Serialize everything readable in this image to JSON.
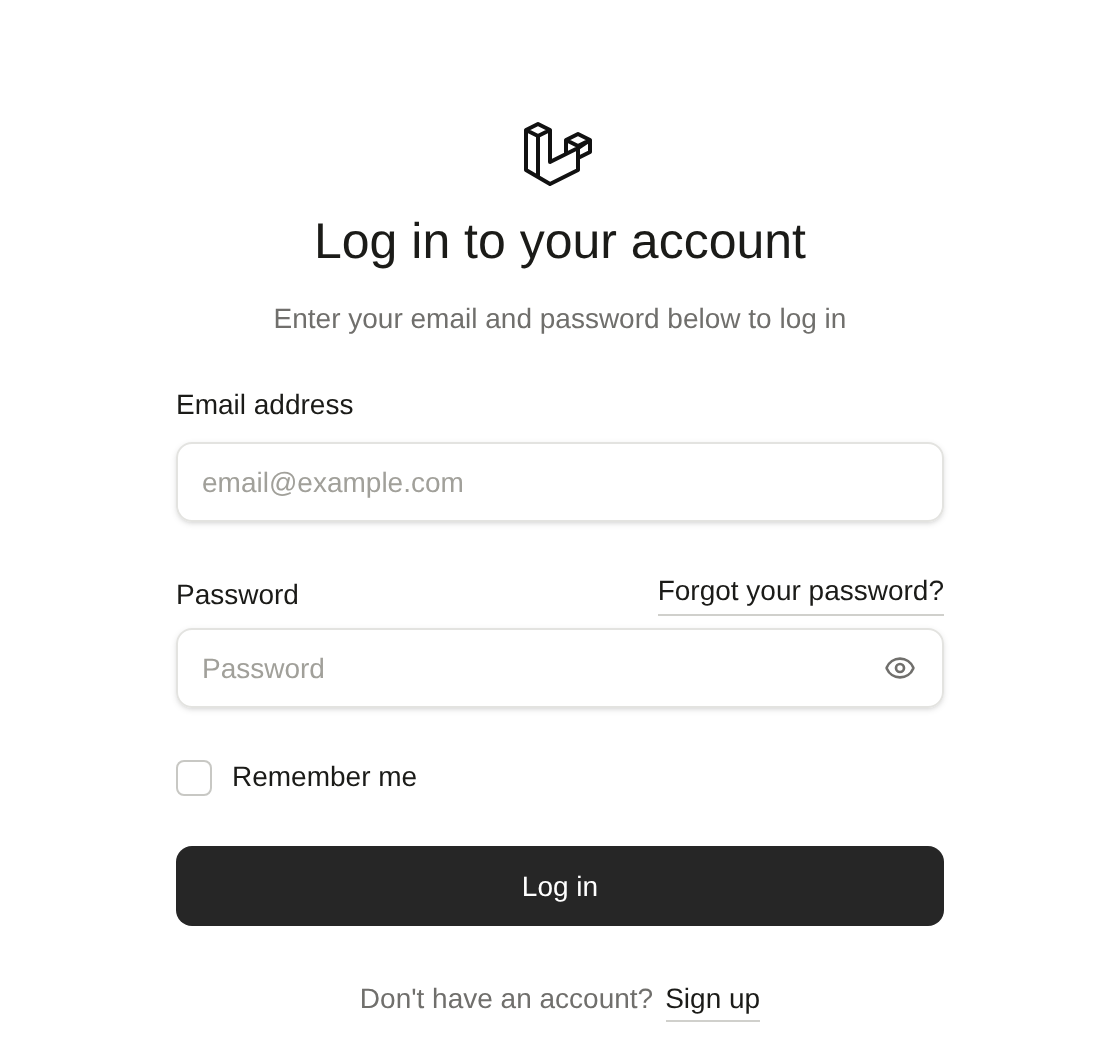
{
  "title": "Log in to your account",
  "subtitle": "Enter your email and password below to log in",
  "email": {
    "label": "Email address",
    "placeholder": "email@example.com"
  },
  "password": {
    "label": "Password",
    "placeholder": "Password",
    "forgot_link": "Forgot your password?"
  },
  "remember": {
    "label": "Remember me",
    "checked": false
  },
  "submit": "Log in",
  "footer": {
    "text": "Don't have an account?",
    "link": "Sign up"
  }
}
